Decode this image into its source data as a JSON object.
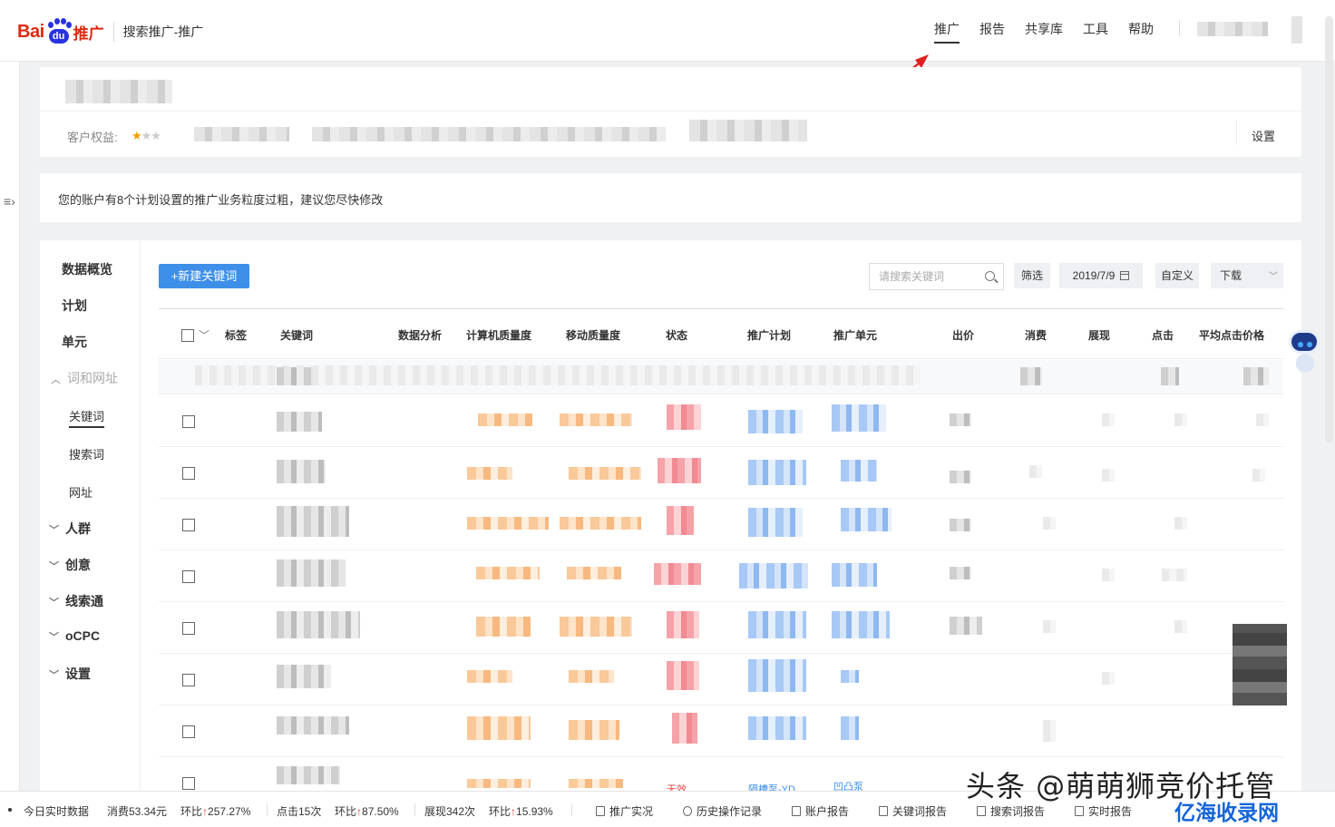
{
  "header": {
    "logo_bai": "Bai",
    "logo_du": "du",
    "logo_tg": "推广",
    "product": "搜索推广-推广",
    "nav": [
      {
        "label": "推广",
        "active": true
      },
      {
        "label": "报告",
        "active": false
      },
      {
        "label": "共享库",
        "active": false
      },
      {
        "label": "工具",
        "active": false
      },
      {
        "label": "帮助",
        "active": false
      }
    ]
  },
  "account": {
    "rights_label": "客户权益:",
    "stars": {
      "filled": "★",
      "empty": "★★"
    },
    "settings": "设置"
  },
  "notice": {
    "text": "您的账户有8个计划设置的推广业务粒度过粗，建议您尽快修改"
  },
  "leftnav": {
    "items": [
      {
        "label": "数据概览"
      },
      {
        "label": "计划"
      },
      {
        "label": "单元"
      },
      {
        "label": "词和网址"
      },
      {
        "label": "关键词"
      },
      {
        "label": "搜索词"
      },
      {
        "label": "网址"
      },
      {
        "label": "人群"
      },
      {
        "label": "创意"
      },
      {
        "label": "线索通"
      },
      {
        "label": "oCPC"
      },
      {
        "label": "设置"
      }
    ]
  },
  "toolbar": {
    "new_keyword": "+新建关键词",
    "search_placeholder": "请搜索关键词",
    "filter": "筛选",
    "date": "2019/7/9",
    "custom": "自定义",
    "download": "下载"
  },
  "table": {
    "columns": [
      "标签",
      "关键词",
      "数据分析",
      "计算机质量度",
      "移动质量度",
      "状态",
      "推广计划",
      "推广单元",
      "出价",
      "消费",
      "展现",
      "点击",
      "平均点击价格"
    ],
    "partial_row": {
      "status": "无效",
      "plan": "隔槽泵-YD",
      "unit": "凹凸泵"
    }
  },
  "bottombar": {
    "today": "今日实时数据",
    "cost": "消费53.34元",
    "cost_change": "环比",
    "cost_pct": "257.27%",
    "clicks": "点击15次",
    "clicks_change": "环比",
    "clicks_pct": "87.50%",
    "impr": "展现342次",
    "impr_change": "环比",
    "impr_pct": "15.93%",
    "links": [
      "推广实况",
      "历史操作记录",
      "账户报告",
      "关键词报告",
      "搜索词报告",
      "实时报告"
    ]
  },
  "overlay": {
    "watermark": "头条 @萌萌狮竞价托管",
    "watermark2": "亿海收录网"
  },
  "colors": {
    "accent": "#3e8fe8",
    "logo_red": "#de2910",
    "logo_blue": "#2932e1",
    "arrow_red": "#e02020"
  }
}
